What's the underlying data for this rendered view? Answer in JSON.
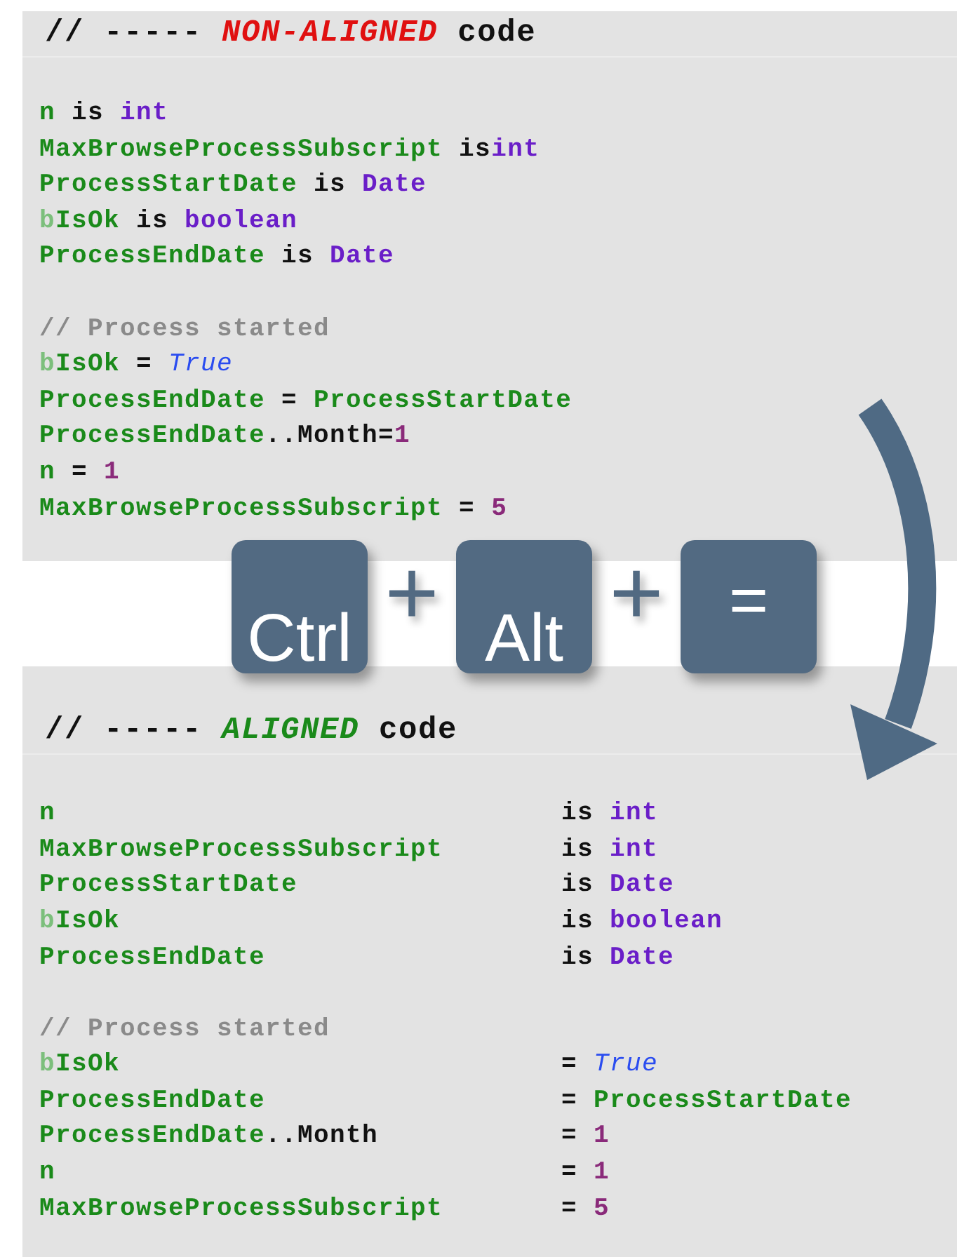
{
  "panels": [
    {
      "header": [
        {
          "text": "// ----- ",
          "kind": "plain"
        },
        {
          "text": "NON-ALIGNED",
          "kind": "alert"
        },
        {
          "text": " code",
          "kind": "plain"
        }
      ],
      "blocks": [
        {
          "lines": [
            {
              "tokens": [
                {
                  "text": "n",
                  "kind": "var"
                },
                {
                  "text": " is ",
                  "kind": "plain"
                },
                {
                  "text": "int",
                  "kind": "type"
                }
              ]
            },
            {
              "tokens": [
                {
                  "text": "MaxBrowseProcessSubscript",
                  "kind": "var"
                },
                {
                  "text": " is",
                  "kind": "plain"
                },
                {
                  "text": "int",
                  "kind": "type"
                }
              ]
            },
            {
              "tokens": [
                {
                  "text": "ProcessStartDate",
                  "kind": "var"
                },
                {
                  "text": " is ",
                  "kind": "plain"
                },
                {
                  "text": "Date",
                  "kind": "type"
                }
              ]
            },
            {
              "tokens": [
                {
                  "text": "b",
                  "kind": "var-prefix"
                },
                {
                  "text": "IsOk",
                  "kind": "var"
                },
                {
                  "text": " is ",
                  "kind": "plain"
                },
                {
                  "text": "boolean",
                  "kind": "type"
                }
              ]
            },
            {
              "tokens": [
                {
                  "text": "ProcessEndDate",
                  "kind": "var"
                },
                {
                  "text": " is ",
                  "kind": "plain"
                },
                {
                  "text": "Date",
                  "kind": "type"
                }
              ]
            }
          ]
        },
        {
          "lines": [
            {
              "tokens": [
                {
                  "text": "// Process started",
                  "kind": "comment"
                }
              ]
            },
            {
              "tokens": [
                {
                  "text": "b",
                  "kind": "var-prefix"
                },
                {
                  "text": "IsOk",
                  "kind": "var"
                },
                {
                  "text": " = ",
                  "kind": "plain"
                },
                {
                  "text": "True",
                  "kind": "bool"
                }
              ]
            },
            {
              "tokens": [
                {
                  "text": "ProcessEndDate",
                  "kind": "var"
                },
                {
                  "text": " = ",
                  "kind": "plain"
                },
                {
                  "text": "ProcessStartDate",
                  "kind": "var"
                }
              ]
            },
            {
              "tokens": [
                {
                  "text": "ProcessEndDate",
                  "kind": "var"
                },
                {
                  "text": "..Month=",
                  "kind": "plain"
                },
                {
                  "text": "1",
                  "kind": "number"
                }
              ]
            },
            {
              "tokens": [
                {
                  "text": "n",
                  "kind": "var"
                },
                {
                  "text": " = ",
                  "kind": "plain"
                },
                {
                  "text": "1",
                  "kind": "number"
                }
              ]
            },
            {
              "tokens": [
                {
                  "text": "MaxBrowseProcessSubscript",
                  "kind": "var"
                },
                {
                  "text": " = ",
                  "kind": "plain"
                },
                {
                  "text": "5",
                  "kind": "number"
                }
              ]
            }
          ]
        }
      ]
    },
    {
      "header": [
        {
          "text": "// ----- ",
          "kind": "plain"
        },
        {
          "text": "ALIGNED",
          "kind": "highlight"
        },
        {
          "text": " code",
          "kind": "plain"
        }
      ],
      "blocks": [
        {
          "lines": [
            {
              "tokens": [
                {
                  "text": "n",
                  "kind": "var"
                }
              ],
              "right": [
                {
                  "text": "is ",
                  "kind": "plain"
                },
                {
                  "text": "int",
                  "kind": "type"
                }
              ]
            },
            {
              "tokens": [
                {
                  "text": "MaxBrowseProcessSubscript",
                  "kind": "var"
                }
              ],
              "right": [
                {
                  "text": "is ",
                  "kind": "plain"
                },
                {
                  "text": "int",
                  "kind": "type"
                }
              ]
            },
            {
              "tokens": [
                {
                  "text": "ProcessStartDate",
                  "kind": "var"
                }
              ],
              "right": [
                {
                  "text": "is ",
                  "kind": "plain"
                },
                {
                  "text": "Date",
                  "kind": "type"
                }
              ]
            },
            {
              "tokens": [
                {
                  "text": "b",
                  "kind": "var-prefix"
                },
                {
                  "text": "IsOk",
                  "kind": "var"
                }
              ],
              "right": [
                {
                  "text": "is ",
                  "kind": "plain"
                },
                {
                  "text": "boolean",
                  "kind": "type"
                }
              ]
            },
            {
              "tokens": [
                {
                  "text": "ProcessEndDate",
                  "kind": "var"
                }
              ],
              "right": [
                {
                  "text": "is ",
                  "kind": "plain"
                },
                {
                  "text": "Date",
                  "kind": "type"
                }
              ]
            }
          ]
        },
        {
          "lines": [
            {
              "tokens": [
                {
                  "text": "// Process started",
                  "kind": "comment"
                }
              ]
            },
            {
              "tokens": [
                {
                  "text": "b",
                  "kind": "var-prefix"
                },
                {
                  "text": "IsOk",
                  "kind": "var"
                }
              ],
              "right": [
                {
                  "text": "= ",
                  "kind": "plain"
                },
                {
                  "text": "True",
                  "kind": "bool"
                }
              ]
            },
            {
              "tokens": [
                {
                  "text": "ProcessEndDate",
                  "kind": "var"
                }
              ],
              "right": [
                {
                  "text": "= ",
                  "kind": "plain"
                },
                {
                  "text": "ProcessStartDate",
                  "kind": "var"
                }
              ]
            },
            {
              "tokens": [
                {
                  "text": "ProcessEndDate",
                  "kind": "var"
                },
                {
                  "text": "..Month",
                  "kind": "plain"
                }
              ],
              "right": [
                {
                  "text": "= ",
                  "kind": "plain"
                },
                {
                  "text": "1",
                  "kind": "number"
                }
              ]
            },
            {
              "tokens": [
                {
                  "text": "n",
                  "kind": "var"
                }
              ],
              "right": [
                {
                  "text": "= ",
                  "kind": "plain"
                },
                {
                  "text": "1",
                  "kind": "number"
                }
              ]
            },
            {
              "tokens": [
                {
                  "text": "MaxBrowseProcessSubscript",
                  "kind": "var"
                }
              ],
              "right": [
                {
                  "text": "= ",
                  "kind": "plain"
                },
                {
                  "text": "5",
                  "kind": "number"
                }
              ]
            }
          ]
        }
      ]
    }
  ],
  "shortcut": {
    "keys": [
      "Ctrl",
      "Alt",
      "="
    ],
    "joiners": [
      "+",
      "+"
    ]
  }
}
